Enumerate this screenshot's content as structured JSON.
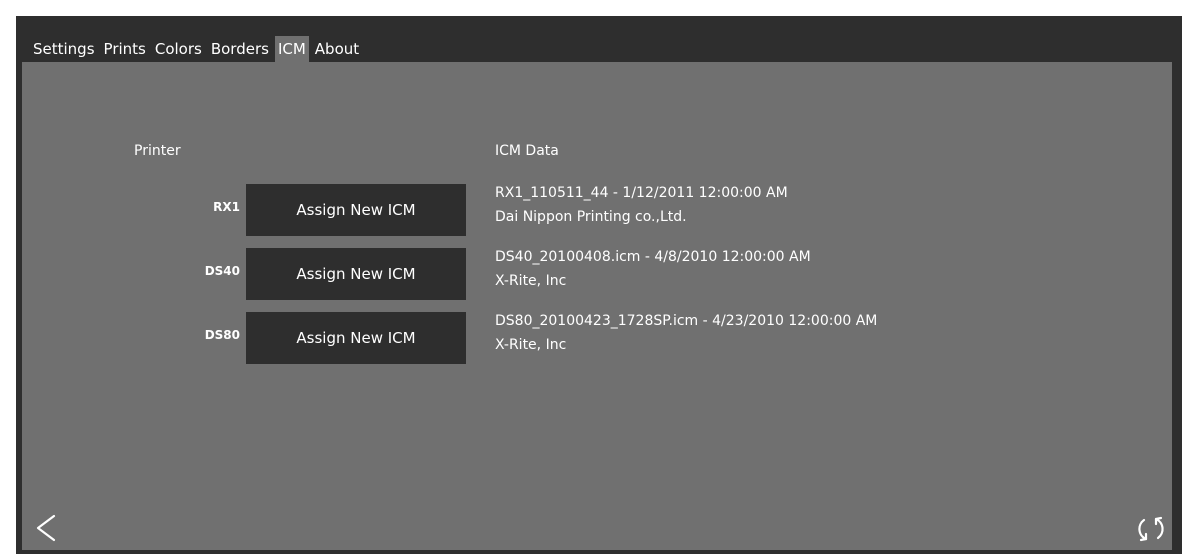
{
  "tabs": [
    {
      "label": "Settings"
    },
    {
      "label": "Prints"
    },
    {
      "label": "Colors"
    },
    {
      "label": "Borders"
    },
    {
      "label": "ICM"
    },
    {
      "label": "About"
    }
  ],
  "active_tab": "ICM",
  "table": {
    "printer_header": "Printer",
    "icm_header": "ICM Data",
    "rows": [
      {
        "printer": "RX1",
        "button_label": "Assign New ICM",
        "icm_file": "RX1_110511_44 - 1/12/2011 12:00:00 AM",
        "icm_vendor": "Dai Nippon Printing co.,Ltd."
      },
      {
        "printer": "DS40",
        "button_label": "Assign New ICM",
        "icm_file": "DS40_20100408.icm - 4/8/2010 12:00:00 AM",
        "icm_vendor": "X-Rite, Inc"
      },
      {
        "printer": "DS80",
        "button_label": "Assign New ICM",
        "icm_file": "DS80_20100423_1728SP.icm - 4/23/2010 12:00:00 AM",
        "icm_vendor": "X-Rite, Inc"
      }
    ]
  },
  "footer": {
    "back_icon": "chevron-left-icon",
    "refresh_icon": "refresh-icon"
  },
  "colors": {
    "window_background": "#2e2e2e",
    "panel_background": "#707070",
    "button_background": "#2e2e2e",
    "text": "#ffffff"
  }
}
